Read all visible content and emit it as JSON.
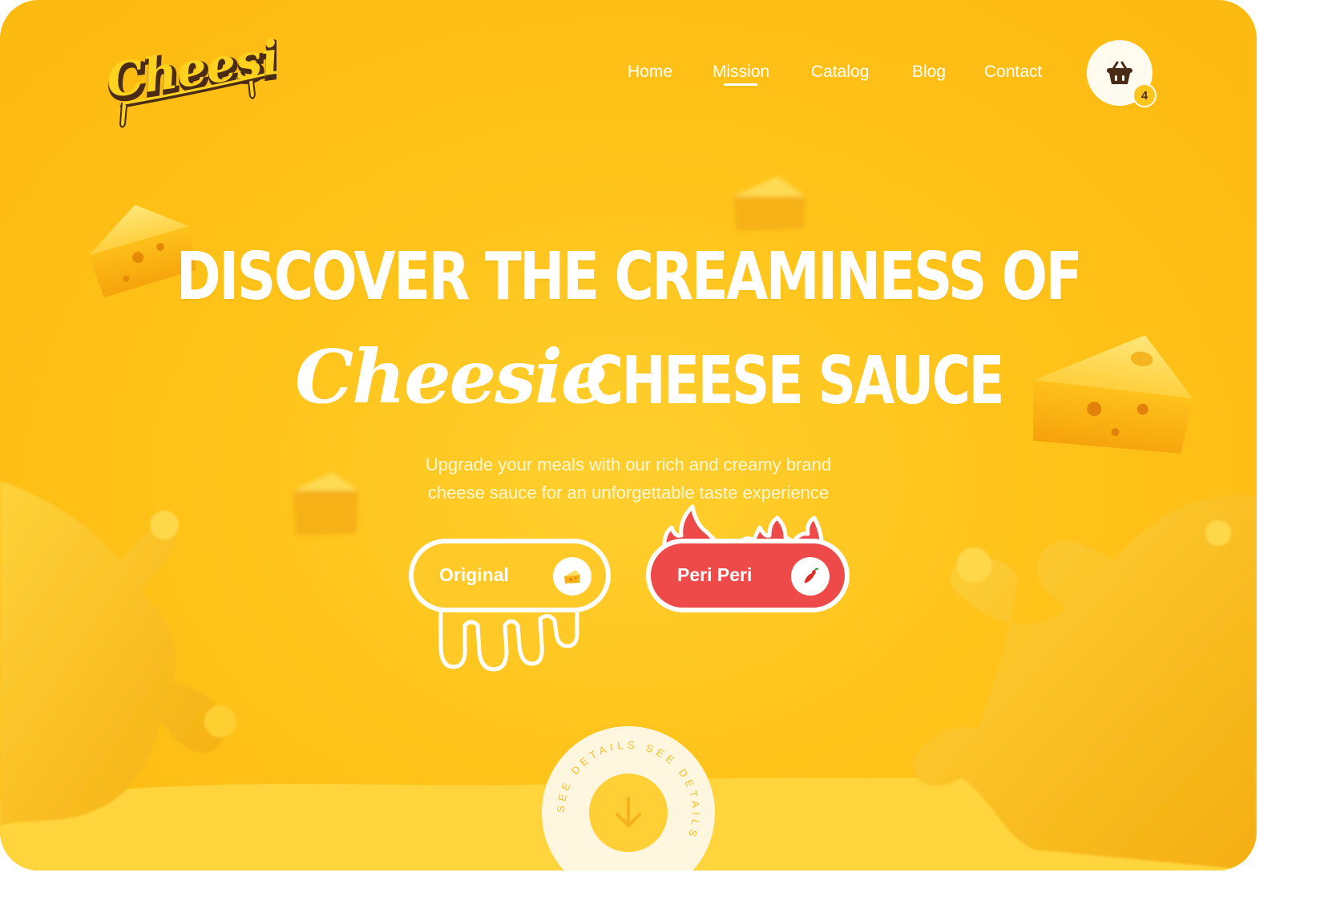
{
  "brand": {
    "logo_text": "Cheesie"
  },
  "nav": {
    "items": [
      {
        "label": "Home"
      },
      {
        "label": "Mission"
      },
      {
        "label": "Catalog"
      },
      {
        "label": "Blog"
      },
      {
        "label": "Contact"
      }
    ],
    "active": "Mission"
  },
  "cart": {
    "count": "4",
    "icon": "basket-icon"
  },
  "hero": {
    "headline_line1": "DISCOVER THE CREAMINESS OF",
    "headline_script": "Cheesie",
    "headline_line2": "CHEESE SAUCE",
    "subtitle_line1": "Upgrade your meals with our rich and creamy brand",
    "subtitle_line2": "cheese sauce for an unforgettable taste experience"
  },
  "flavors": [
    {
      "label": "Original",
      "icon": "cheese-icon",
      "color": "#ffc928"
    },
    {
      "label": "Peri Peri",
      "icon": "chili-icon",
      "color": "#ee4a4a"
    }
  ],
  "see_details": {
    "ring_text": "SEE DETAILS SEE DETAILS",
    "icon": "arrow-down-icon"
  },
  "colors": {
    "background": "#ffc31a",
    "accent_dark": "#4a2b16",
    "peri": "#ee4a4a"
  }
}
